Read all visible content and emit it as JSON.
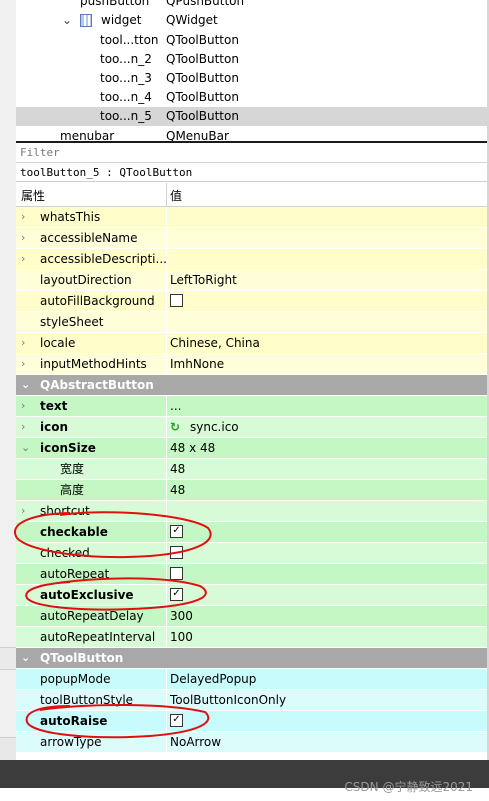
{
  "tree": {
    "rows": [
      {
        "name": "pushButton",
        "class": "QPushButton"
      },
      {
        "name": "widget",
        "class": "QWidget"
      },
      {
        "name": "tool...tton",
        "class": "QToolButton"
      },
      {
        "name": "too...n_2",
        "class": "QToolButton"
      },
      {
        "name": "too...n_3",
        "class": "QToolButton"
      },
      {
        "name": "too...n_4",
        "class": "QToolButton"
      },
      {
        "name": "too...n_5",
        "class": "QToolButton"
      },
      {
        "name": "menubar",
        "class": "QMenuBar"
      }
    ]
  },
  "filter": {
    "placeholder": "Filter"
  },
  "object_info": "toolButton_5 : QToolButton",
  "header": {
    "property": "属性",
    "value": "值"
  },
  "props": {
    "whatsThis": {
      "name": "whatsThis",
      "value": ""
    },
    "accessibleName": {
      "name": "accessibleName",
      "value": ""
    },
    "accessibleDescription": {
      "name": "accessibleDescripti...",
      "value": ""
    },
    "layoutDirection": {
      "name": "layoutDirection",
      "value": "LeftToRight"
    },
    "autoFillBackground": {
      "name": "autoFillBackground",
      "checked": false
    },
    "styleSheet": {
      "name": "styleSheet",
      "value": ""
    },
    "locale": {
      "name": "locale",
      "value": "Chinese, China"
    },
    "inputMethodHints": {
      "name": "inputMethodHints",
      "value": "ImhNone"
    },
    "cat_abstract": {
      "name": "QAbstractButton"
    },
    "text": {
      "name": "text",
      "value": "..."
    },
    "icon": {
      "name": "icon",
      "value": "sync.ico"
    },
    "iconSize": {
      "name": "iconSize",
      "value": "48 x 48"
    },
    "width": {
      "name": "宽度",
      "value": "48"
    },
    "height": {
      "name": "高度",
      "value": "48"
    },
    "shortcut": {
      "name": "shortcut",
      "value": ""
    },
    "checkable": {
      "name": "checkable",
      "checked": true
    },
    "checked": {
      "name": "checked",
      "checked": false
    },
    "autoRepeat": {
      "name": "autoRepeat",
      "checked": false
    },
    "autoExclusive": {
      "name": "autoExclusive",
      "checked": true
    },
    "autoRepeatDelay": {
      "name": "autoRepeatDelay",
      "value": "300"
    },
    "autoRepeatInterval": {
      "name": "autoRepeatInterval",
      "value": "100"
    },
    "cat_tool": {
      "name": "QToolButton"
    },
    "popupMode": {
      "name": "popupMode",
      "value": "DelayedPopup"
    },
    "toolButtonStyle": {
      "name": "toolButtonStyle",
      "value": "ToolButtonIconOnly"
    },
    "autoRaise": {
      "name": "autoRaise",
      "checked": true
    },
    "arrowType": {
      "name": "arrowType",
      "value": "NoArrow"
    }
  },
  "watermark": "CSDN @宁静致远2021",
  "colors": {
    "annotation": "#e01010",
    "category": "#a8a8a8",
    "selected": "#d6d6d6"
  }
}
